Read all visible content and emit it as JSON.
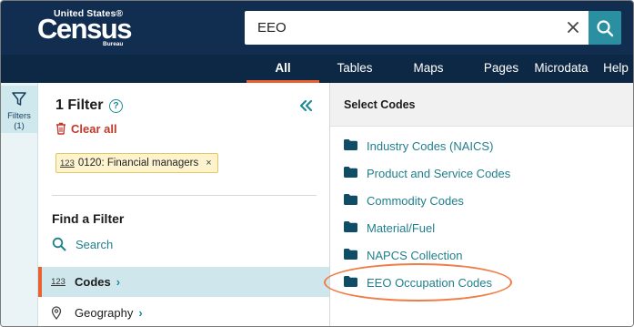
{
  "header": {
    "logo": {
      "line1": "United States®",
      "line2": "Census",
      "line3": "Bureau"
    },
    "search": {
      "value": "EEO",
      "placeholder": ""
    },
    "icons": {
      "clear": "close-icon",
      "search": "search-icon"
    }
  },
  "nav": {
    "tabs": [
      {
        "label": "All",
        "active": true
      },
      {
        "label": "Tables"
      },
      {
        "label": "Maps"
      },
      {
        "label": "Pages"
      },
      {
        "label": "Microdata"
      },
      {
        "label": "Help"
      }
    ]
  },
  "rail": {
    "label": "Filters (1)",
    "icon": "funnel-icon"
  },
  "filters": {
    "title": "1 Filter",
    "help_glyph": "?",
    "clear_all": "Clear all",
    "chip": {
      "prefix": "123",
      "label": "0120: Financial managers",
      "remove": "×"
    },
    "find_title": "Find a Filter",
    "search_link": "Search",
    "items": [
      {
        "prefix": "123",
        "label": "Codes",
        "active": true
      },
      {
        "label": "Geography",
        "icon": "map-pin-icon"
      }
    ]
  },
  "codes": {
    "title": "Select Codes",
    "items": [
      "Industry Codes (NAICS)",
      "Product and Service Codes",
      "Commodity Codes",
      "Material/Fuel",
      "NAPCS Collection",
      "EEO Occupation Codes"
    ],
    "highlighted_index": 5,
    "highlight_color": "#ef7d45"
  },
  "colors": {
    "header_bg": "#112e51",
    "accent": "#e8612e",
    "teal": "#1f7f8c"
  }
}
